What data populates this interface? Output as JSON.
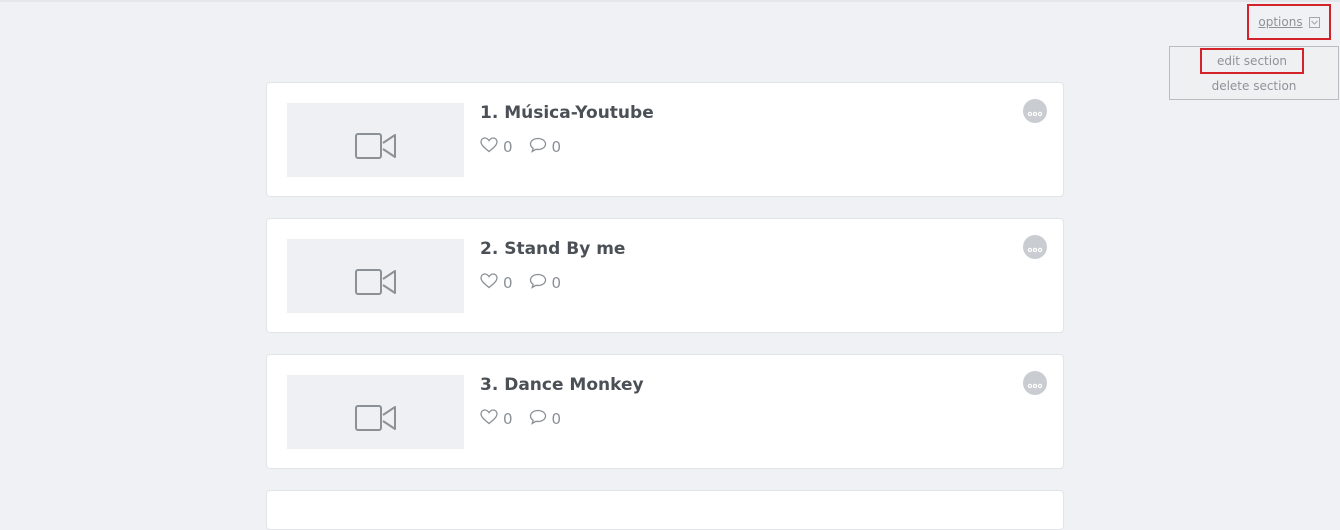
{
  "header": {
    "options_label": "options",
    "menu": {
      "edit_label": "edit section",
      "delete_label": "delete section"
    }
  },
  "items": [
    {
      "title": "1. Música-Youtube",
      "likes": "0",
      "comments": "0"
    },
    {
      "title": "2. Stand By me",
      "likes": "0",
      "comments": "0"
    },
    {
      "title": "3. Dance Monkey",
      "likes": "0",
      "comments": "0"
    }
  ],
  "colors": {
    "highlight": "#d3222a",
    "background": "#eff1f4"
  }
}
